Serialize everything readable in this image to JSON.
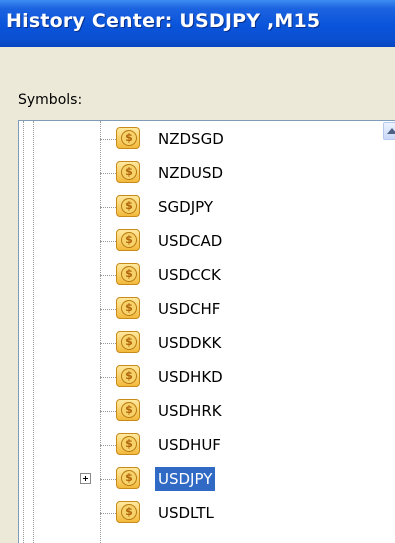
{
  "window": {
    "title": "History Center: USDJPY ,M15"
  },
  "symbols_panel": {
    "label": "Symbols:",
    "items": [
      {
        "label": "NZDSGD",
        "icon": "dollar-icon",
        "selected": false
      },
      {
        "label": "NZDUSD",
        "icon": "dollar-icon",
        "selected": false
      },
      {
        "label": "SGDJPY",
        "icon": "dollar-icon",
        "selected": false
      },
      {
        "label": "USDCAD",
        "icon": "dollar-icon",
        "selected": false
      },
      {
        "label": "USDCCK",
        "icon": "dollar-icon",
        "selected": false
      },
      {
        "label": "USDCHF",
        "icon": "dollar-icon",
        "selected": false
      },
      {
        "label": "USDDKK",
        "icon": "dollar-icon",
        "selected": false
      },
      {
        "label": "USDHKD",
        "icon": "dollar-icon",
        "selected": false
      },
      {
        "label": "USDHRK",
        "icon": "dollar-icon",
        "selected": false
      },
      {
        "label": "USDHUF",
        "icon": "dollar-icon",
        "selected": false
      },
      {
        "label": "USDJPY",
        "icon": "dollar-icon",
        "selected": true,
        "expandable": true
      },
      {
        "label": "USDLTL",
        "icon": "dollar-icon",
        "selected": false
      }
    ]
  },
  "colors": {
    "titlebar": "#0a54db",
    "selection": "#316ac5",
    "dialog_bg": "#ece9d8"
  }
}
